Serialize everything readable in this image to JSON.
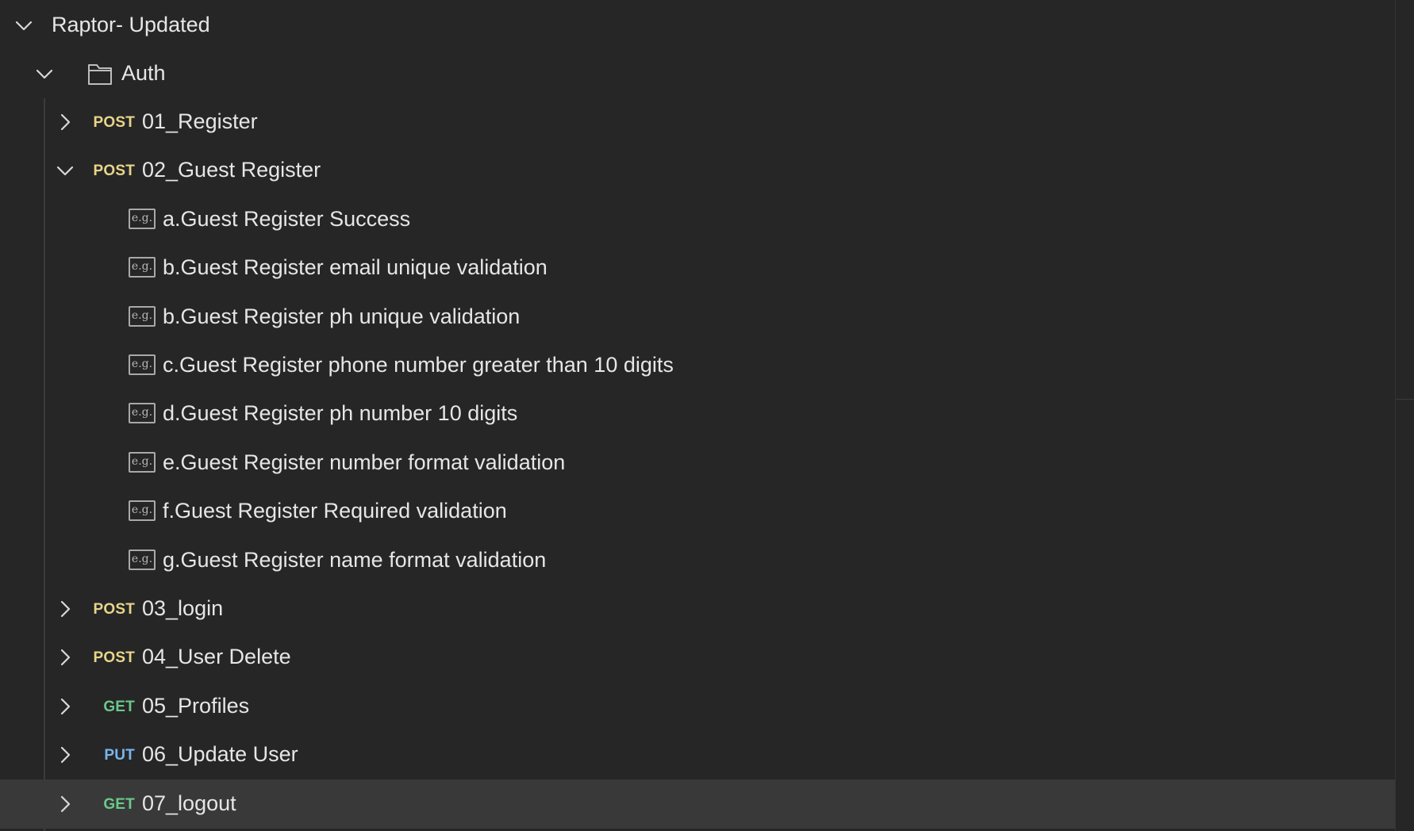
{
  "collection": {
    "name": "Raptor- Updated",
    "expanded": true
  },
  "folder": {
    "name": "Auth",
    "icon": "folder-icon",
    "expanded": true
  },
  "requests": [
    {
      "method": "POST",
      "name": "01_Register",
      "expanded": false
    },
    {
      "method": "POST",
      "name": "02_Guest Register",
      "expanded": true,
      "examples": [
        "a.Guest Register Success",
        "b.Guest Register email unique validation",
        "b.Guest Register ph unique validation",
        "c.Guest Register phone number greater than 10 digits",
        "d.Guest Register ph number 10 digits",
        "e.Guest Register number format validation",
        "f.Guest Register Required validation",
        "g.Guest Register name format validation"
      ]
    },
    {
      "method": "POST",
      "name": "03_login",
      "expanded": false
    },
    {
      "method": "POST",
      "name": "04_User Delete",
      "expanded": false
    },
    {
      "method": "GET",
      "name": "05_Profiles",
      "expanded": false
    },
    {
      "method": "PUT",
      "name": "06_Update User",
      "expanded": false
    },
    {
      "method": "GET",
      "name": "07_logout",
      "expanded": false,
      "selected": true
    }
  ],
  "example_icon_text": "e.g.",
  "colors": {
    "background": "#262626",
    "selected_row": "#393939",
    "post": "#e8d58a",
    "get": "#6bc98a",
    "put": "#7ab4f0",
    "text": "#e6e6e6"
  }
}
